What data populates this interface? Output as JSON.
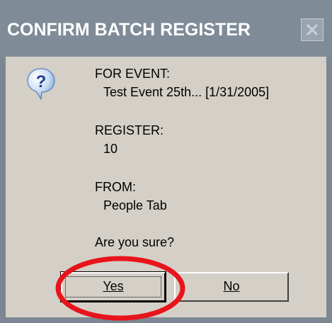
{
  "window": {
    "title": "CONFIRM BATCH REGISTER",
    "close_icon": "close-icon"
  },
  "dialog": {
    "icon": "question-icon",
    "event_label": "FOR EVENT:",
    "event_value": "Test Event 25th... [1/31/2005]",
    "register_label": "REGISTER:",
    "register_value": "10",
    "from_label": "FROM:",
    "from_value": "People Tab",
    "prompt": "Are you sure?"
  },
  "buttons": {
    "yes_label": "Yes",
    "no_label": "No"
  },
  "colors": {
    "titlebar": "#7f8b97",
    "client": "#d4d0c8",
    "annotation": "#e8141b"
  }
}
